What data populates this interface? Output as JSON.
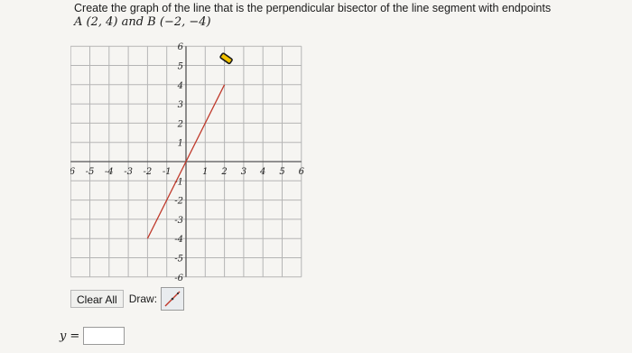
{
  "question": {
    "prompt": "Create the graph of the line that is the perpendicular bisector of the line segment with endpoints",
    "endpoints": "A (2, 4) and B (−2, −4)"
  },
  "graph": {
    "x_ticks": [
      "-6",
      "-5",
      "-4",
      "-3",
      "-2",
      "-1",
      "1",
      "2",
      "3",
      "4",
      "5",
      "6"
    ],
    "y_ticks": [
      "6",
      "5",
      "4",
      "3",
      "2",
      "1",
      "-1",
      "-2",
      "-3",
      "-4",
      "-5",
      "-6"
    ],
    "segment_color": "#c0392b",
    "grid_color": "#b5b5b5",
    "axis_color": "#555555"
  },
  "toolbar": {
    "clear_label": "Clear All",
    "draw_label": "Draw:"
  },
  "answer": {
    "label": "y",
    "equals": "=",
    "value": ""
  }
}
